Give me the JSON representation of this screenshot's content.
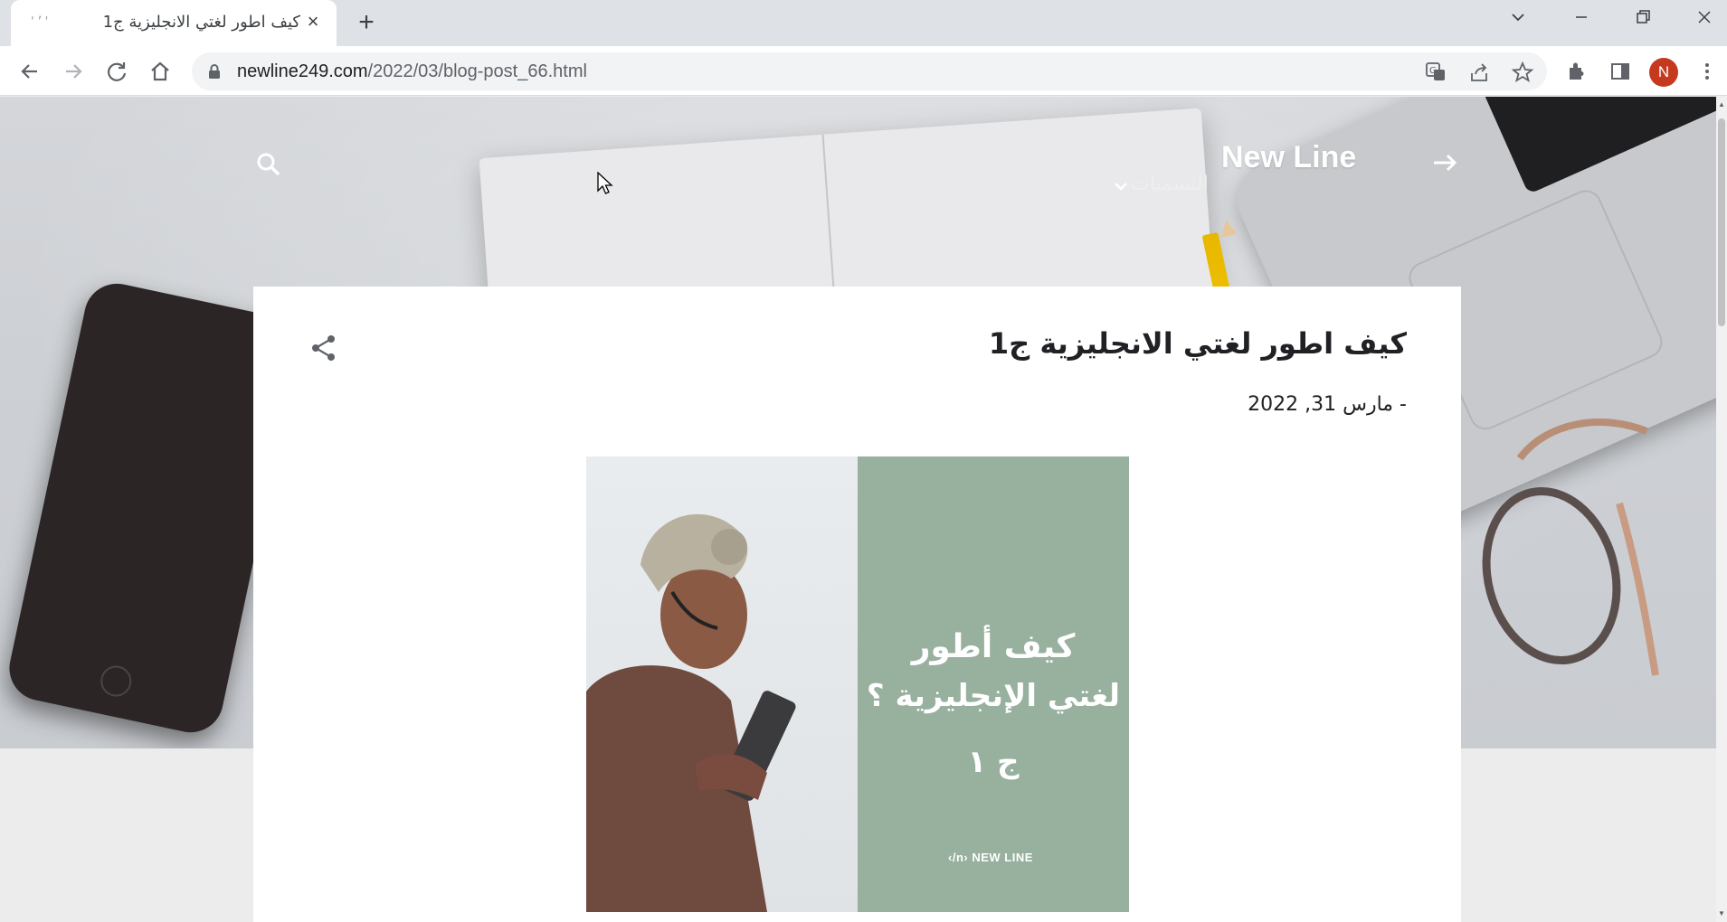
{
  "browser": {
    "tab": {
      "title": "كيف اطور لغتي الانجليزية ج1",
      "favicon": "'ʼ'"
    },
    "address": {
      "domain": "newline249.com",
      "path": "/2022/03/blog-post_66.html"
    },
    "profile_initial": "N",
    "icons": [
      "back-icon",
      "forward-icon",
      "reload-icon",
      "home-icon",
      "lock-icon",
      "translate-icon",
      "share-icon",
      "star-icon",
      "extensions-icon",
      "side-panel-icon",
      "menu-icon"
    ]
  },
  "blog": {
    "title": "New Line",
    "labels_menu": "التسميات"
  },
  "post": {
    "title": "كيف اطور لغتي الانجليزية ج1",
    "date": "- مارس 31, 2022",
    "image": {
      "line1": "كيف أطور",
      "line2": "لغتي الإنجليزية ؟",
      "line3": "ج ١",
      "brand": "NEW LINE",
      "brand_mark": "‹/n›"
    }
  },
  "colors": {
    "accent_green": "#98b09e",
    "avatar": "#c5391f",
    "tabbar": "#dee1e6"
  }
}
